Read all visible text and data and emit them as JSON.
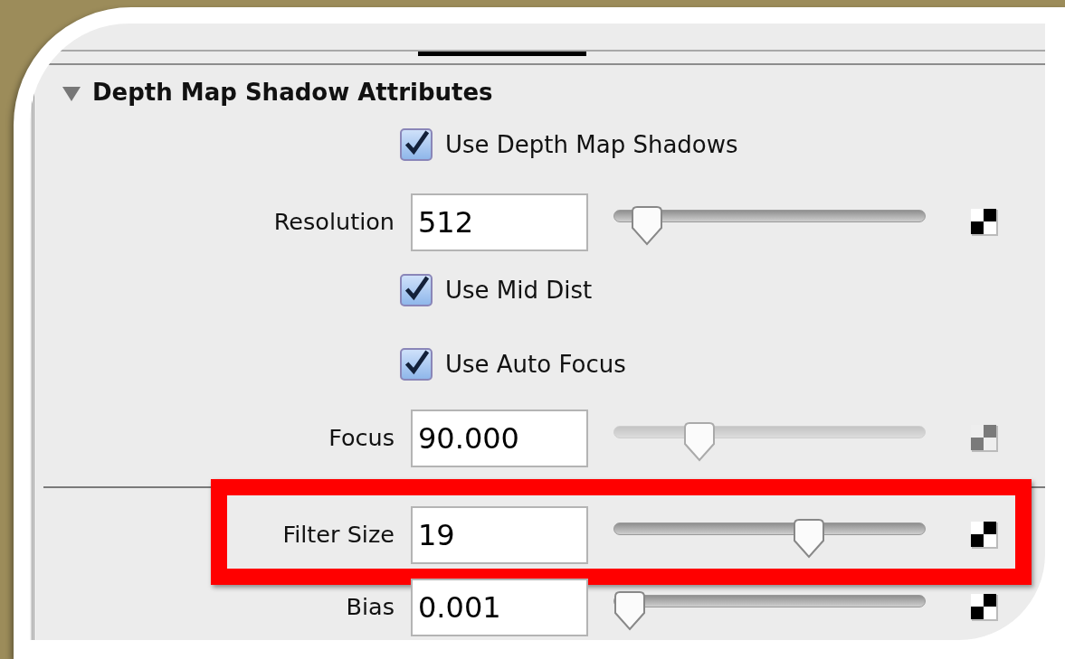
{
  "section": {
    "title": "Depth Map Shadow Attributes",
    "expanded": true
  },
  "rows": [
    {
      "kind": "checkbox",
      "label": "Use Depth Map Shadows",
      "checked": true
    },
    {
      "kind": "slider",
      "label": "Resolution",
      "value": "512",
      "level": 0.06,
      "dimmed": false,
      "highlighted": false
    },
    {
      "kind": "checkbox",
      "label": "Use Mid Dist",
      "checked": true
    },
    {
      "kind": "checkbox",
      "label": "Use Auto Focus",
      "checked": true
    },
    {
      "kind": "slider",
      "label": "Focus",
      "value": "90.000",
      "level": 0.25,
      "dimmed": true,
      "highlighted": false
    },
    {
      "kind": "divider"
    },
    {
      "kind": "slider",
      "label": "Filter Size",
      "value": "19",
      "level": 0.64,
      "dimmed": false,
      "highlighted": true
    },
    {
      "kind": "slider",
      "label": "Bias",
      "value": "0.001",
      "level": 0.0,
      "dimmed": false,
      "highlighted": false
    }
  ]
}
